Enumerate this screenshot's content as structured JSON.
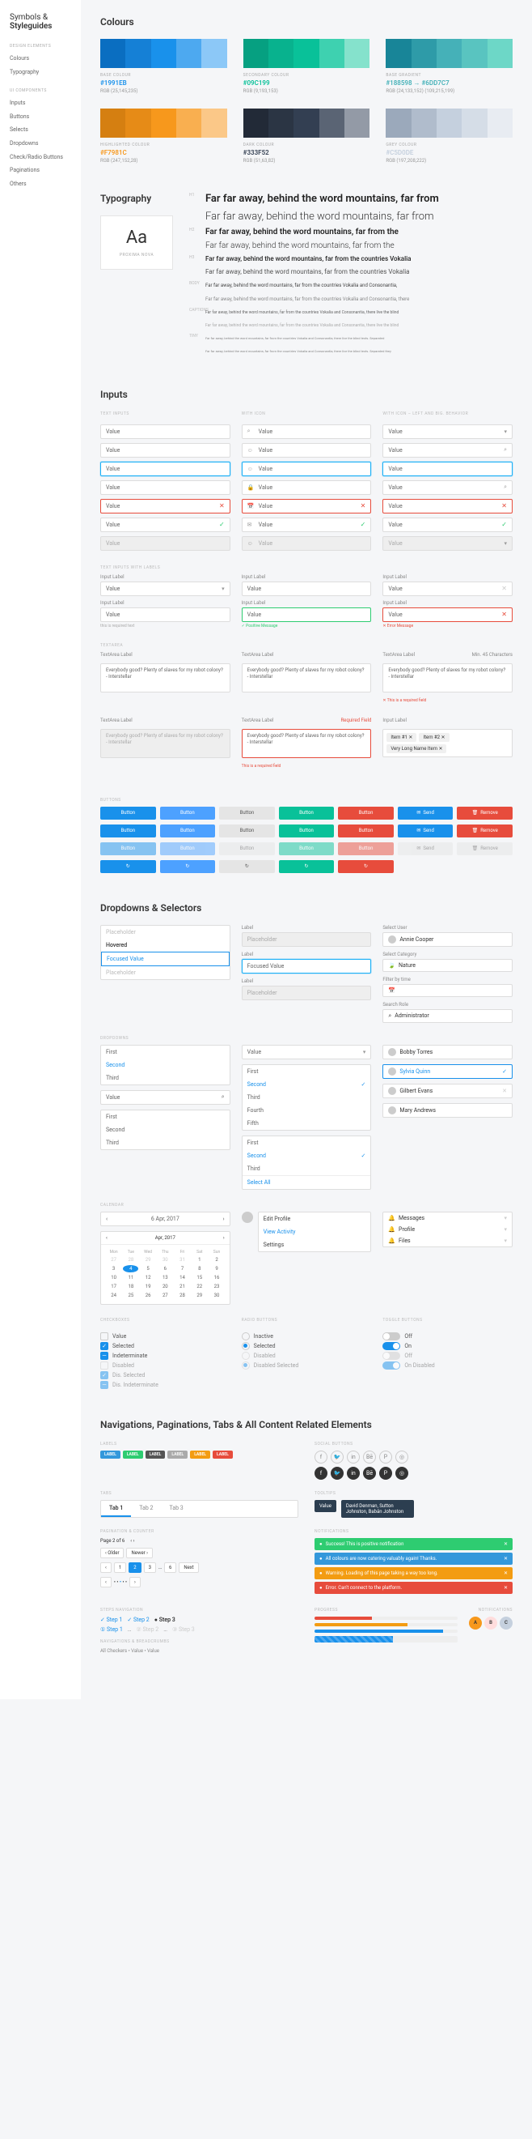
{
  "sidebar": {
    "title_a": "Symbols",
    "title_b": "Styleguides",
    "groups": [
      {
        "name": "Design Elements",
        "items": [
          "Colours",
          "Typography"
        ]
      },
      {
        "name": "UI Components",
        "items": [
          "Inputs",
          "Buttons",
          "Selects",
          "Dropdowns",
          "Check/Radio Buttons",
          "Paginations",
          "Others"
        ]
      }
    ]
  },
  "colours": {
    "title": "Colours",
    "items": [
      {
        "name": "Base Colour",
        "hex": "#1991EB",
        "rgb": "RGB (25,145,235)",
        "shades": [
          "#0a6ec1",
          "#1580d6",
          "#1991eb",
          "#4da9f0",
          "#8cc8f7"
        ]
      },
      {
        "name": "Secondary Colour",
        "hex": "#09C199",
        "rgb": "RGB (9,193,153)",
        "shades": [
          "#06a081",
          "#08b28e",
          "#09c199",
          "#3ed1b0",
          "#85e2cc"
        ]
      },
      {
        "name": "Base Gradient",
        "hex": "#188598 → #6DD7C7",
        "rgb": "RGB (24,133,152)   (109,215,199)",
        "shades": [
          "#188598",
          "#2e9ba8",
          "#45b1b8",
          "#59c4c0",
          "#6dd7c7"
        ]
      },
      {
        "name": "Highlighted Colour",
        "hex": "#F7981C",
        "rgb": "RGB (247,152,28)",
        "shades": [
          "#d57f11",
          "#e68b17",
          "#f7981c",
          "#f9af50",
          "#fbc888"
        ]
      },
      {
        "name": "Dark Colour",
        "hex": "#333F52",
        "rgb": "RGB (51,63,82)",
        "shades": [
          "#222a37",
          "#2b3544",
          "#333f52",
          "#5a6474",
          "#939aa6"
        ]
      },
      {
        "name": "Grey Colour",
        "hex": "#C5D0DE",
        "rgb": "RGB (197,208,222)",
        "shades": [
          "#9ba9bb",
          "#b0bccc",
          "#c5d0de",
          "#d5dde7",
          "#e8ecf2"
        ]
      }
    ]
  },
  "typography": {
    "title": "Typography",
    "font_sample": "Aa",
    "font_name": "Proxima Nova",
    "lines": [
      {
        "tag": "H1",
        "cls": "h1s",
        "text": "Far far away, behind the word mountains, far from"
      },
      {
        "tag": "",
        "cls": "h1l",
        "text": "Far far away, behind the word mountains, far from"
      },
      {
        "tag": "H2",
        "cls": "h2s",
        "text": "Far far away, behind the word mountains, far from the"
      },
      {
        "tag": "",
        "cls": "h2l",
        "text": "Far far away, behind the word mountains, far from the"
      },
      {
        "tag": "H3",
        "cls": "h3s",
        "text": "Far far away, behind the word mountains, far from the countries Vokalia"
      },
      {
        "tag": "",
        "cls": "h3l",
        "text": "Far far away, behind the word mountains, far from the countries Vokalia"
      },
      {
        "tag": "BODY",
        "cls": "bodys",
        "text": "Far far away, behind the word mountains, far from the countries Vokalia and Consonantia,"
      },
      {
        "tag": "",
        "cls": "bodyl",
        "text": "Far far away, behind the word mountains, far from the countries Vokalia and Consonantia, there"
      },
      {
        "tag": "CAPTIONS",
        "cls": "caps",
        "text": "Far far away, behind the word mountains, far from the countries Vokalia and Consonantia, there live the blind"
      },
      {
        "tag": "",
        "cls": "capl",
        "text": "Far far away, behind the word mountains, far from the countries Vokalia and Consonantia, there live the blind"
      },
      {
        "tag": "TINY",
        "cls": "tinys",
        "text": "Far far away, behind the word mountains, far from the countries Vokalia and Consonantia, there live the blind texts. Separated"
      },
      {
        "tag": "",
        "cls": "tinys",
        "text": "Far far away, behind the word mountains, far from the countries Vokalia and Consonantia, there live the blind texts. Separated they"
      }
    ]
  },
  "inputs": {
    "title": "Inputs",
    "groups": {
      "t1": "Text Inputs",
      "t2": "With Icon",
      "t3": "With Icon – Left and Big. Behavior"
    },
    "value": "Value",
    "label": "Input Label",
    "ta_label": "TextArea Label",
    "ta_req": "Required Field",
    "ta_hint": "This is a required field",
    "ta_chars": "Min. 45 Characters",
    "ta_content": "Everybody good? Plenty of slaves for my robot colony? - Interstellar",
    "tags_label": "Input Label",
    "tags_hint": "this is required text",
    "msg_pos": "Positive Message",
    "msg_err": "Error Message",
    "tag_items": [
      "Item #1",
      "Item #2",
      "Very Long Name Item"
    ]
  },
  "buttons": {
    "title": "Buttons",
    "label": "Button",
    "send": "Send",
    "remove": "Remove"
  },
  "dropdowns": {
    "title": "Dropdowns & Selectors",
    "states": [
      "Placeholder",
      "Hovered",
      "Focused Value",
      "Placeholder"
    ],
    "label_txt": "Label",
    "placeholder": "Placeholder",
    "focused": "Focused Value",
    "select_user": "Select User",
    "user1": "Annie Cooper",
    "sel_cat": "Select Category",
    "cat1": "Nature",
    "filter": "Filter by time",
    "search_role": "Search Role",
    "role": "Administrator",
    "list_a": [
      "First",
      "Second",
      "Third"
    ],
    "value": "Value",
    "long_list": [
      "First",
      "Second",
      "Third",
      "Fourth",
      "Fifth"
    ],
    "sel_list": [
      "First",
      "Second",
      "Third"
    ],
    "sel_last": "Select All",
    "people": [
      "Bobby Torres",
      "Sylvia Quinn",
      "Gilbert Evans",
      "Mary Andrews"
    ]
  },
  "calendar": {
    "date": "6 Apr, 2017",
    "month": "Apr, 2017",
    "dow": [
      "Mon",
      "Tue",
      "Wed",
      "Thu",
      "Fri",
      "Sat",
      "Sun"
    ],
    "days": [
      27,
      28,
      29,
      30,
      31,
      1,
      2,
      3,
      4,
      5,
      6,
      7,
      8,
      9,
      10,
      11,
      12,
      13,
      14,
      15,
      16,
      17,
      18,
      19,
      20,
      21,
      22,
      23,
      24,
      25,
      26,
      27,
      28,
      29,
      30
    ],
    "today_idx": 8
  },
  "profile_menu": [
    "Edit Profile",
    "View Activity",
    "Settings"
  ],
  "notif_menu": {
    "items": [
      "Messages",
      "Profile",
      "Files"
    ]
  },
  "checkboxes": {
    "t": "Checkboxes",
    "items": [
      "Value",
      "Selected",
      "Indeterminate",
      "Disabled",
      "Dis. Selected",
      "Dis. Indeterminate"
    ]
  },
  "radios": {
    "t": "Radio Buttons",
    "items": [
      "Inactive",
      "Selected",
      "Disabled",
      "Disabled Selected"
    ]
  },
  "toggles": {
    "t": "Toggle Buttons",
    "items": [
      "Off",
      "On",
      "Off",
      "On Disabled"
    ]
  },
  "nav": {
    "title": "Navigations, Paginations, Tabs & All Content Related Elements",
    "labels": [
      "LABEL",
      "LABEL",
      "LABEL",
      "LABEL",
      "LABEL",
      "LABEL"
    ],
    "label_colors": [
      "#3498db",
      "#2ecc71",
      "#555",
      "#aaa",
      "#f39c12",
      "#e74c3c"
    ],
    "socials": [
      "fb",
      "tw",
      "in",
      "be",
      "pi",
      "ig"
    ],
    "tabs": [
      "Tab 1",
      "Tab 2",
      "Tab 3"
    ],
    "tooltip1": "Value",
    "tooltip2": "David Denman, Sutton Johnston, Babán Johnston",
    "counter_t": "Counter",
    "newer": "Newer",
    "older": "Older",
    "next": "Next",
    "page_of": "Page 2 of 6",
    "notifs": [
      {
        "c": "gn",
        "t": "Success! This is positive notification"
      },
      {
        "c": "bl",
        "t": "All colours are now catering valuably again! Thanks."
      },
      {
        "c": "or",
        "t": "Warning. Loading of this page taking a way too long."
      },
      {
        "c": "rd",
        "t": "Error. Can't connect to the platform."
      }
    ],
    "steps1": [
      "Step 1",
      "Step 2",
      "Step 3"
    ],
    "steps2": [
      "Step 1",
      "Step 2",
      "Step 3"
    ],
    "bc": "All Checkers  •  Value  •  Value",
    "notifications": "Notifications",
    "progress_title": "Progress",
    "people": [
      {
        "c": "#f7981c",
        "t": "A"
      },
      {
        "c": "#fdd",
        "t": "B"
      },
      {
        "c": "#c5d0de",
        "t": "C"
      }
    ]
  }
}
